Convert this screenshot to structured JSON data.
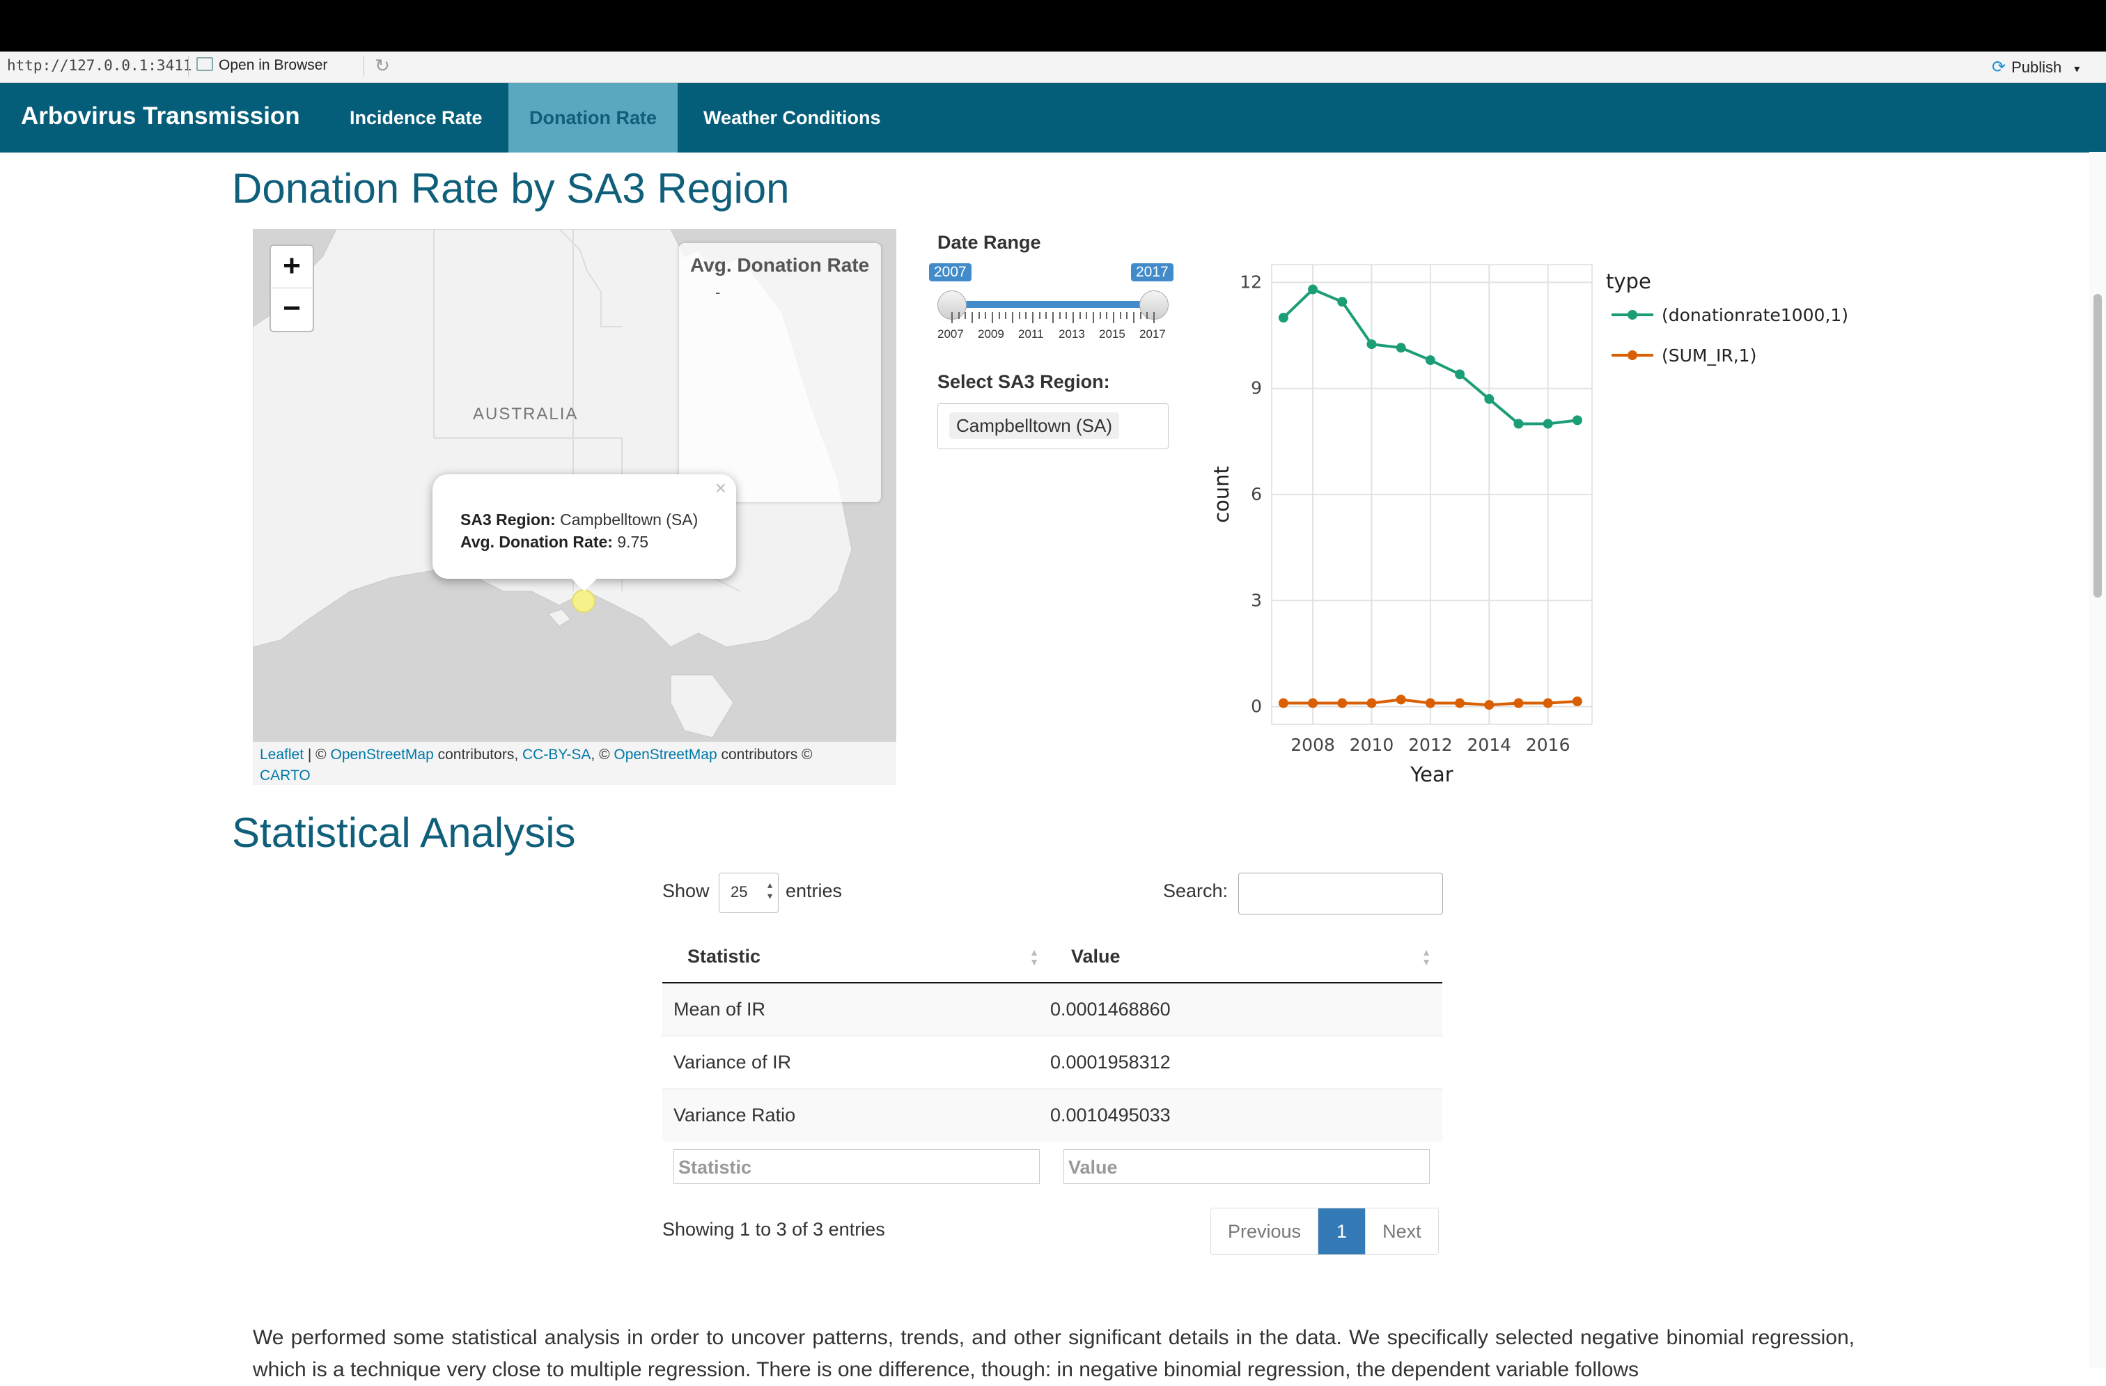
{
  "browser": {
    "url": "http://127.0.0.1:3411",
    "open_in_browser": "Open in Browser",
    "publish": "Publish"
  },
  "navbar": {
    "brand": "Arbovirus Transmission",
    "tabs": [
      {
        "label": "Incidence Rate",
        "active": false
      },
      {
        "label": "Donation Rate",
        "active": true
      },
      {
        "label": "Weather Conditions",
        "active": false
      }
    ]
  },
  "page_title": "Donation Rate by SA3 Region",
  "map": {
    "zoom_in": "+",
    "zoom_out": "−",
    "legend_title": "Avg. Donation Rate",
    "legend_value": "-",
    "country_label": "AUSTRALIA",
    "popup": {
      "region_label": "SA3 Region:",
      "region_value": "Campbelltown (SA)",
      "rate_label": "Avg. Donation Rate:",
      "rate_value": "9.75",
      "close": "×"
    },
    "attribution": {
      "leaflet": "Leaflet",
      "sep1": " | © ",
      "osm1": "OpenStreetMap",
      "contributors1": " contributors, ",
      "ccbysa": "CC-BY-SA",
      "sep2": ", © ",
      "osm2": "OpenStreetMap",
      "contributors2": " contributors © ",
      "carto": "CARTO"
    }
  },
  "controls": {
    "date_range_label": "Date Range",
    "date_min_value": "2007",
    "date_max_value": "2017",
    "tick_labels": [
      "2007",
      "2009",
      "2011",
      "2013",
      "2015",
      "2017"
    ],
    "region_label": "Select SA3 Region:",
    "region_value": "Campbelltown (SA)"
  },
  "chart_data": {
    "type": "line",
    "x": [
      2007,
      2008,
      2009,
      2010,
      2011,
      2012,
      2013,
      2014,
      2015,
      2016,
      2017
    ],
    "series": [
      {
        "name": "(donationrate1000,1)",
        "color": "#1b9e77",
        "values": [
          11.0,
          11.8,
          11.45,
          10.25,
          10.15,
          9.8,
          9.4,
          8.7,
          8.0,
          8.0,
          8.1
        ]
      },
      {
        "name": "(SUM_IR,1)",
        "color": "#d95f02",
        "values": [
          0.1,
          0.1,
          0.1,
          0.1,
          0.2,
          0.1,
          0.1,
          0.05,
          0.1,
          0.1,
          0.15
        ]
      }
    ],
    "xlabel": "Year",
    "ylabel": "count",
    "legend_title": "type",
    "xticks": [
      "2008",
      "2010",
      "2012",
      "2014",
      "2016"
    ],
    "yticks": [
      "0",
      "3",
      "6",
      "9",
      "12"
    ],
    "ylim": [
      -0.5,
      12.5
    ],
    "xlim": [
      2006.6,
      2017.5
    ],
    "grid": true,
    "legend_position": "right"
  },
  "stats_title": "Statistical Analysis",
  "table": {
    "show_label": "Show",
    "entries_label": "entries",
    "length_value": "25",
    "search_label": "Search:",
    "columns": [
      "Statistic",
      "Value"
    ],
    "rows": [
      [
        "Mean of IR",
        "0.0001468860"
      ],
      [
        "Variance of IR",
        "0.0001958312"
      ],
      [
        "Variance Ratio",
        "0.0010495033"
      ]
    ],
    "filter_placeholders": [
      "Statistic",
      "Value"
    ],
    "info": "Showing 1 to 3 of 3 entries",
    "pager": {
      "previous": "Previous",
      "current": "1",
      "next": "Next"
    }
  },
  "paragraph": "We performed some statistical analysis in order to uncover patterns, trends, and other significant details in the data. We specifically selected negative binomial regression, which is a technique very close to multiple regression. There is one difference, though: in negative binomial regression, the dependent variable follows"
}
